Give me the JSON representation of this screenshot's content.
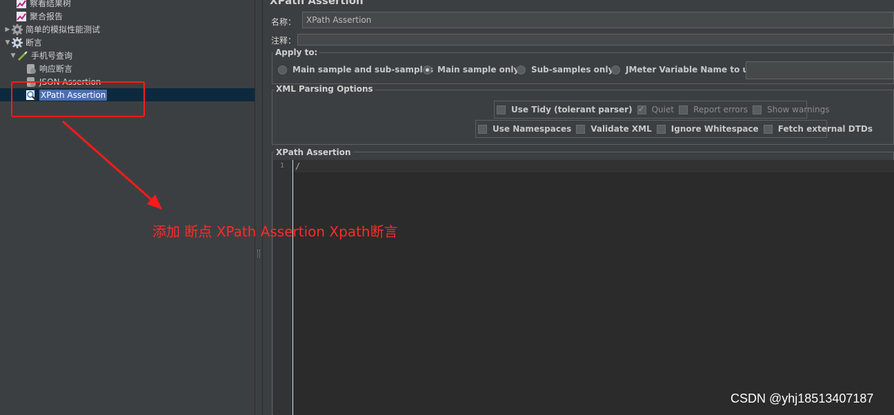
{
  "tree": {
    "items": [
      {
        "label": "察看结果树",
        "icon": "graph-icon"
      },
      {
        "label": "聚合报告",
        "icon": "graph-icon"
      },
      {
        "label": "简单的模拟性能测试",
        "icon": "gear-icon"
      },
      {
        "label": "断言",
        "icon": "gear-icon"
      },
      {
        "label": "手机号查询",
        "icon": "sampler-pen-icon"
      },
      {
        "label": "响应断言",
        "icon": "assertion-icon"
      },
      {
        "label": "JSON Assertion",
        "icon": "assertion-icon"
      },
      {
        "label": "XPath Assertion",
        "icon": "xpath-assertion-icon"
      }
    ]
  },
  "panel": {
    "title": "XPath Assertion",
    "name_label": "名称：",
    "name_value": "XPath Assertion",
    "comment_label": "注释：",
    "comment_value": ""
  },
  "apply_to": {
    "title": "Apply to:",
    "options": [
      {
        "label": "Main sample and sub-samples",
        "selected": false
      },
      {
        "label": "Main sample only",
        "selected": true
      },
      {
        "label": "Sub-samples only",
        "selected": false
      },
      {
        "label": "JMeter Variable Name to use",
        "selected": false
      }
    ],
    "variable_value": ""
  },
  "xml_parsing": {
    "title": "XML Parsing Options",
    "row1": [
      {
        "label": "Use Tidy (tolerant parser)",
        "checked": false,
        "enabled": true
      },
      {
        "label": "Quiet",
        "checked": true,
        "enabled": false
      },
      {
        "label": "Report errors",
        "checked": false,
        "enabled": false
      },
      {
        "label": "Show warnings",
        "checked": false,
        "enabled": false
      }
    ],
    "row2": [
      {
        "label": "Use Namespaces",
        "checked": false,
        "enabled": true
      },
      {
        "label": "Validate XML",
        "checked": false,
        "enabled": true
      },
      {
        "label": "Ignore Whitespace",
        "checked": false,
        "enabled": true
      },
      {
        "label": "Fetch external DTDs",
        "checked": false,
        "enabled": true
      }
    ]
  },
  "xpath_assertion": {
    "title": "XPath Assertion",
    "line_number": "1",
    "code": "/"
  },
  "annotation": {
    "text": "添加  断点  XPath Assertion  Xpath断言",
    "color": "#ff2a2a"
  },
  "watermark": "CSDN @yhj18513407187",
  "colors": {
    "background": "#3c3f41",
    "selection": "#4b6eaf",
    "selected_row": "#0d293e",
    "editor": "#2b2b2b"
  }
}
